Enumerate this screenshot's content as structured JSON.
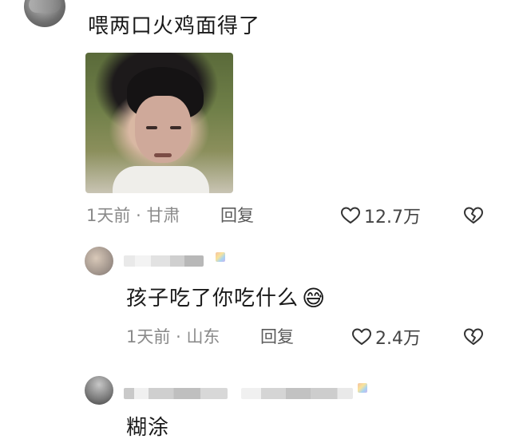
{
  "comment1": {
    "text": "喂两口火鸡面得了",
    "time": "1天前",
    "sep": "·",
    "location": "甘肃",
    "reply_label": "回复",
    "likes": "12.7万"
  },
  "reply1": {
    "text": "孩子吃了你吃什么",
    "emoji": "😅",
    "time": "1天前",
    "sep": "·",
    "location": "山东",
    "reply_label": "回复",
    "likes": "2.4万"
  },
  "reply2": {
    "text": "糊涂"
  },
  "icons": {
    "heart": "heart-icon",
    "dislike": "broken-heart-icon"
  },
  "colors": {
    "meta_gray": "#8a8a8a",
    "text_dark": "#1a1a1a"
  }
}
